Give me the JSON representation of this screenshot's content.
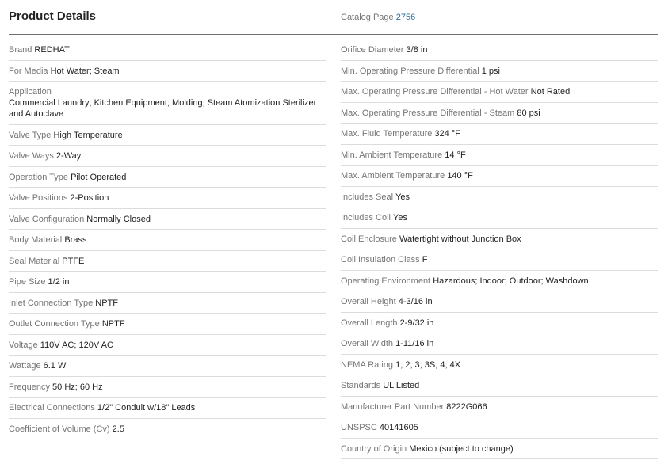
{
  "header": {
    "title": "Product Details",
    "catalog_label": "Catalog Page",
    "catalog_value": "2756"
  },
  "left": [
    {
      "label": "Brand",
      "value": "REDHAT"
    },
    {
      "label": "For Media",
      "value": "Hot Water; Steam"
    },
    {
      "label": "Application",
      "value": "Commercial Laundry; Kitchen Equipment; Molding; Steam Atomization Sterilizer and Autoclave"
    },
    {
      "label": "Valve Type",
      "value": "High Temperature"
    },
    {
      "label": "Valve Ways",
      "value": "2-Way"
    },
    {
      "label": "Operation Type",
      "value": "Pilot Operated"
    },
    {
      "label": "Valve Positions",
      "value": "2-Position"
    },
    {
      "label": "Valve Configuration",
      "value": "Normally Closed"
    },
    {
      "label": "Body Material",
      "value": "Brass"
    },
    {
      "label": "Seal Material",
      "value": "PTFE"
    },
    {
      "label": "Pipe Size",
      "value": "1/2 in"
    },
    {
      "label": "Inlet Connection Type",
      "value": "NPTF"
    },
    {
      "label": "Outlet Connection Type",
      "value": "NPTF"
    },
    {
      "label": "Voltage",
      "value": "110V AC; 120V AC"
    },
    {
      "label": "Wattage",
      "value": "6.1 W"
    },
    {
      "label": "Frequency",
      "value": "50 Hz; 60 Hz"
    },
    {
      "label": "Electrical Connections",
      "value": "1/2\" Conduit w/18\" Leads"
    },
    {
      "label": "Coefficient of Volume (Cv)",
      "value": "2.5"
    }
  ],
  "right": [
    {
      "label": "Orifice Diameter",
      "value": "3/8 in"
    },
    {
      "label": "Min. Operating Pressure Differential",
      "value": "1 psi"
    },
    {
      "label": "Max. Operating Pressure Differential - Hot Water",
      "value": "Not Rated"
    },
    {
      "label": "Max. Operating Pressure Differential - Steam",
      "value": "80 psi"
    },
    {
      "label": "Max. Fluid Temperature",
      "value": "324 °F"
    },
    {
      "label": "Min. Ambient Temperature",
      "value": "14 °F"
    },
    {
      "label": "Max. Ambient Temperature",
      "value": "140 °F"
    },
    {
      "label": "Includes Seal",
      "value": "Yes"
    },
    {
      "label": "Includes Coil",
      "value": "Yes"
    },
    {
      "label": "Coil Enclosure",
      "value": "Watertight without Junction Box"
    },
    {
      "label": "Coil Insulation Class",
      "value": "F"
    },
    {
      "label": "Operating Environment",
      "value": "Hazardous; Indoor; Outdoor; Washdown"
    },
    {
      "label": "Overall Height",
      "value": "4-3/16 in"
    },
    {
      "label": "Overall Length",
      "value": "2-9/32 in"
    },
    {
      "label": "Overall Width",
      "value": "1-11/16 in"
    },
    {
      "label": "NEMA Rating",
      "value": "1; 2; 3; 3S; 4; 4X"
    },
    {
      "label": "Standards",
      "value": "UL Listed"
    },
    {
      "label": "Manufacturer Part Number",
      "value": "8222G066"
    },
    {
      "label": "UNSPSC",
      "value": "40141605"
    },
    {
      "label": "Country of Origin",
      "value": "Mexico (subject to change)"
    }
  ]
}
